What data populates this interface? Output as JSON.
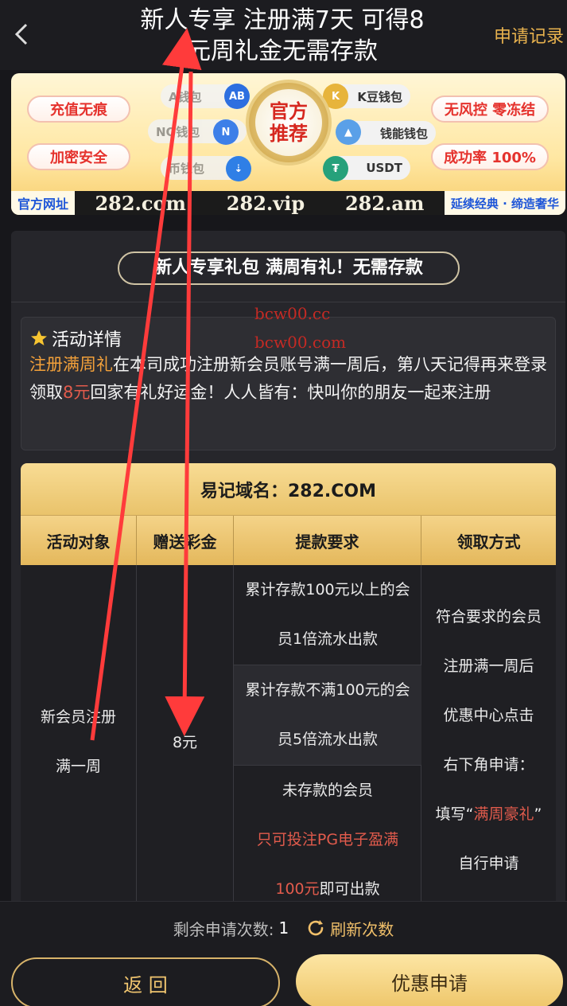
{
  "header": {
    "title_line1": "新人专享 注册满7天 可得8",
    "title_line2": "元周礼金无需存款",
    "apply_record": "申请记录"
  },
  "banner": {
    "pills": [
      "充值无痕",
      "加密安全",
      "无风控 零冻结",
      "成功率 100%"
    ],
    "wallets": [
      "A钱包",
      "NO钱包",
      "K豆钱包",
      "钱能钱包",
      "USDT"
    ],
    "wallet_partial": "币钱包",
    "seal_line1": "官方",
    "seal_line2": "推荐",
    "domain_label": "官方网址",
    "domains": [
      "282.com",
      "282.vip",
      "282.am"
    ],
    "slogan": "延续经典 · 缔造奢华"
  },
  "card": {
    "title": "新人专享礼包 满周有礼！无需存款",
    "detail_heading": "活动详情",
    "detail_seg1": "注册满周礼",
    "detail_seg2": "在本司成功注册新会员账号满一周后，第八天记得再来登录领取",
    "detail_seg3": "8元",
    "detail_seg4": "回家有礼好运金！人人皆有：快叫你的朋友一起来注册",
    "watermark1": "bcw00.cc",
    "watermark2": "bcw00.com"
  },
  "table": {
    "caption": "易记域名：282.COM",
    "headers": [
      "活动对象",
      "赠送彩金",
      "提款要求",
      "领取方式"
    ],
    "target_line1": "新会员注册",
    "target_line2": "满一周",
    "bonus": "8元",
    "req1_line1": "累计存款100元以上的会",
    "req1_line2": "员1倍流水出款",
    "req2_line1": "累计存款不满100元的会",
    "req2_line2": "员5倍流水出款",
    "req3_line1": "未存款的会员",
    "req3_line2": "只可投注PG电子盈满",
    "req3_line3_a": "100元",
    "req3_line3_b": "即可出款",
    "method_1": "符合要求的会员",
    "method_2": "注册满一周后",
    "method_3": "优惠中心点击",
    "method_4": "右下角申请：",
    "method_5a": "填写“",
    "method_5b": "满周豪礼",
    "method_5c": "”",
    "method_6": "自行申请"
  },
  "bottom": {
    "remain_label": "剩余申请次数:",
    "remain_count": "1",
    "refresh_label": "刷新次数",
    "back_label": "返 回",
    "apply_label": "优惠申请"
  },
  "colors": {
    "gold": "#f0c56f",
    "red": "#e25b4c",
    "orange": "#f2a03a",
    "annotation": "#ff3b3b"
  }
}
